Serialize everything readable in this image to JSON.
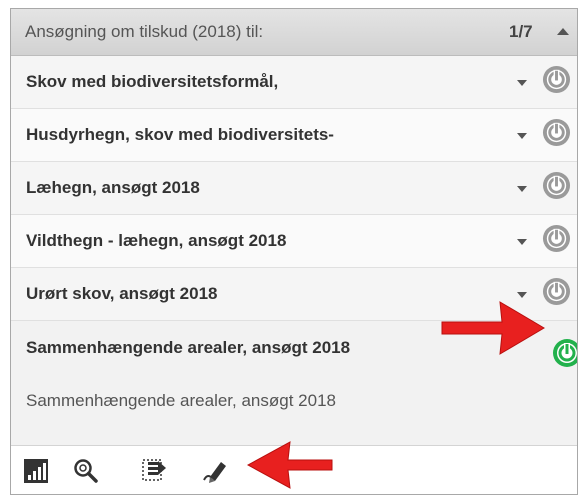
{
  "header": {
    "title": "Ansøgning om tilskud (2018) til:",
    "page_indicator": "1/7"
  },
  "items": [
    {
      "label": "Skov med biodiversitetsformål,"
    },
    {
      "label": "Husdyrhegn, skov med biodiversitets-"
    },
    {
      "label": "Læhegn, ansøgt 2018"
    },
    {
      "label": "Vildthegn - læhegn, ansøgt 2018"
    },
    {
      "label": "Urørt skov, ansøgt 2018"
    }
  ],
  "expanded_item": {
    "title": "Sammenhængende arealer, ansøgt 2018",
    "description": "Sammenhængende arealer, ansøgt 2018"
  },
  "toolbar": {
    "icons": [
      "chart-bars-icon",
      "magnify-icon",
      "select-list-icon",
      "pen-icon"
    ]
  },
  "colors": {
    "power_inactive": "#9a9a9a",
    "power_active": "#22b14c",
    "annotation_arrow": "#e8201f"
  }
}
